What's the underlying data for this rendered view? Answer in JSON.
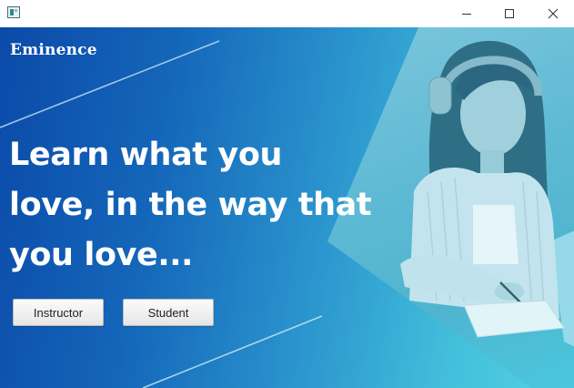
{
  "window": {
    "title": "",
    "controls": {
      "minimize": "minimize-icon",
      "maximize": "maximize-icon",
      "close": "close-icon"
    }
  },
  "brand": {
    "name": "Eminence"
  },
  "hero": {
    "headline_lines": [
      "Learn what you",
      "love, in the way that",
      "you love..."
    ],
    "image": "woman-with-headphones-writing-notes"
  },
  "actions": {
    "instructor_label": "Instructor",
    "student_label": "Student"
  },
  "colors": {
    "gradient_start": "#0b4aa9",
    "gradient_end": "#55d3e3",
    "text": "#ffffff",
    "button_bg": "#f0f0f0"
  }
}
